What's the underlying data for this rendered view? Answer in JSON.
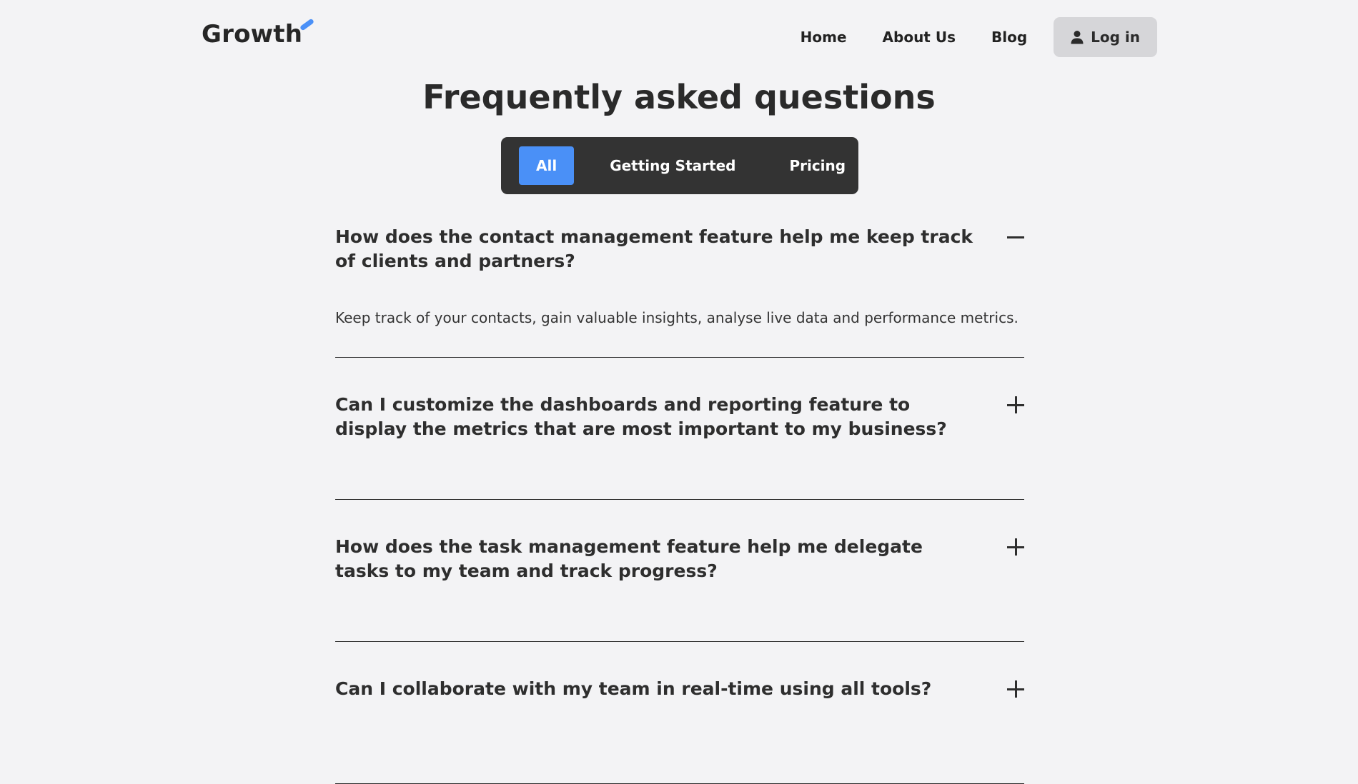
{
  "header": {
    "logo_text": "Growth",
    "nav": {
      "home": "Home",
      "about": "About Us",
      "blog": "Blog"
    },
    "login_label": "Log in"
  },
  "title": "Frequently asked questions",
  "tabs": [
    {
      "label": "All",
      "active": true
    },
    {
      "label": "Getting Started",
      "active": false
    },
    {
      "label": "Pricing",
      "active": false
    }
  ],
  "faqs": [
    {
      "question": "How does the contact management feature help me keep track of clients and partners?",
      "answer": "Keep track of your contacts, gain valuable insights, analyse live data and performance metrics.",
      "expanded": true
    },
    {
      "question": "Can I customize the dashboards and reporting feature to display the metrics that are most important to my business?",
      "expanded": false
    },
    {
      "question": "How does the task management feature help me delegate tasks to my team and track progress?",
      "expanded": false
    },
    {
      "question": "Can I collaborate with my team in real-time using all tools?",
      "expanded": false
    }
  ],
  "colors": {
    "accent": "#4a90f7",
    "background": "#f3f3f5",
    "tabs_background": "#333333",
    "login_background": "#d6d6d9"
  },
  "icons": {
    "login": "user-icon",
    "expanded": "minus-icon",
    "collapsed": "plus-icon"
  }
}
